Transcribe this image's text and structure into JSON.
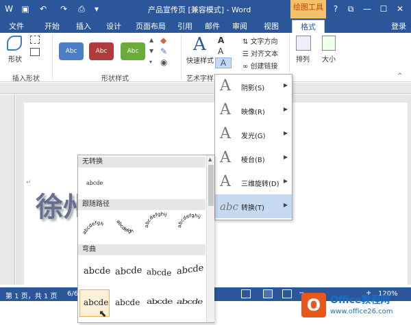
{
  "titlebar": {
    "title": "产品宣传页 [兼容模式] - Word",
    "drawing_tools": "绘图工具",
    "help": "?",
    "restore": "⧉",
    "minimize": "—",
    "maximize": "☐",
    "close": "✕"
  },
  "tabs": {
    "file": "文件",
    "home": "开始",
    "insert": "插入",
    "design": "设计",
    "layout": "页面布局",
    "references": "引用",
    "mailings": "邮件",
    "review": "审阅",
    "view": "视图",
    "format": "格式",
    "login": "登录"
  },
  "ribbon": {
    "shape_label": "形状",
    "insert_shapes": "插入形状",
    "shape_styles": "形状样式",
    "style_sample": "Abc",
    "quick_styles": "快速样式",
    "art_styles": "艺术字样",
    "text_direction": "文字方向",
    "align_text": "对齐文本",
    "create_link": "创建链接",
    "arrange": "排列",
    "size": "大小",
    "colors": {
      "blue": "#4a7fc8",
      "red": "#b23a3a",
      "green": "#6aac3a"
    }
  },
  "effects_menu": {
    "items": [
      {
        "label": "阴影(S)",
        "glyph": "A"
      },
      {
        "label": "映像(R)",
        "glyph": "A"
      },
      {
        "label": "发光(G)",
        "glyph": "A"
      },
      {
        "label": "棱台(B)",
        "glyph": "A"
      },
      {
        "label": "三维旋转(D)",
        "glyph": "A"
      },
      {
        "label": "转换(T)",
        "glyph": "abc"
      }
    ]
  },
  "gallery": {
    "no_transform": "无转换",
    "no_transform_sample": "abcde",
    "follow_path": "跟随路径",
    "path_samples": [
      "abcdefgh",
      "abcdefgh",
      "abcdefghij",
      "abcdefghij"
    ],
    "warp": "弯曲",
    "warp_samples": [
      "abcde",
      "abcde",
      "abcde",
      "abcde",
      "abcde",
      "abcde",
      "abcde",
      "abcde"
    ]
  },
  "document": {
    "big_text": "徐州",
    "return_mark": "↵"
  },
  "status": {
    "page": "第 1 页，共 1 页",
    "words": "6/6",
    "zoom": "120%",
    "zoom_minus": "−",
    "zoom_plus": "+"
  },
  "watermark": {
    "line1": "Office教程网",
    "line2": "www.office26.com"
  }
}
